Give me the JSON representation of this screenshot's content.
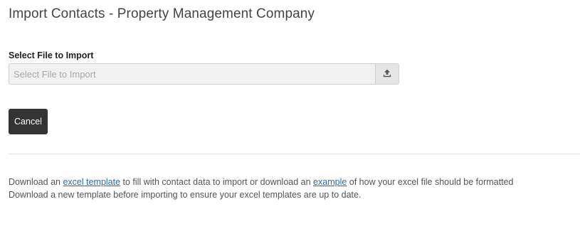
{
  "page": {
    "title": "Import Contacts - Property Management Company"
  },
  "file_field": {
    "label": "Select File to Import",
    "placeholder": "Select File to Import",
    "value": "",
    "upload_icon": "upload-icon"
  },
  "actions": {
    "cancel_label": "Cancel"
  },
  "info": {
    "line1_prefix": "Download an ",
    "excel_template_link": "excel template",
    "line1_middle": " to fill with contact data to import or download an ",
    "example_link": "example",
    "line1_suffix": " of how your excel file should be formatted",
    "line2": "Download a new template before importing to ensure your excel templates are up to date."
  },
  "colors": {
    "link": "#2a6bb0",
    "cancel_button_bg": "#333333"
  }
}
